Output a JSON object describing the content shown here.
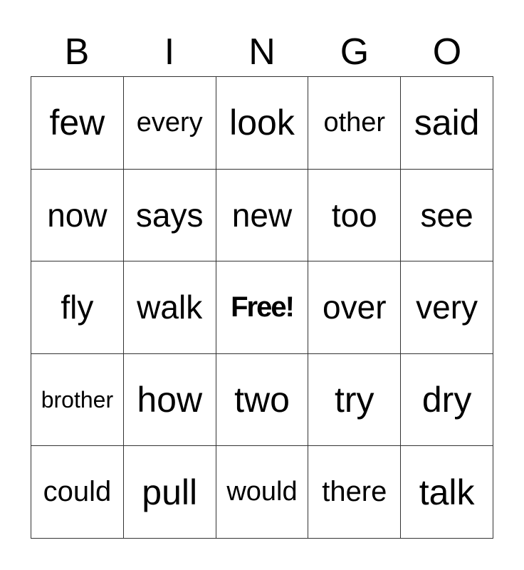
{
  "header": {
    "letters": [
      "B",
      "I",
      "N",
      "G",
      "O"
    ]
  },
  "board": {
    "rows": [
      [
        {
          "word": "few",
          "size": "xl"
        },
        {
          "word": "every",
          "size": "s"
        },
        {
          "word": "look",
          "size": "xl"
        },
        {
          "word": "other",
          "size": "s"
        },
        {
          "word": "said",
          "size": "xl"
        }
      ],
      [
        {
          "word": "now",
          "size": "l"
        },
        {
          "word": "says",
          "size": "l"
        },
        {
          "word": "new",
          "size": "l"
        },
        {
          "word": "too",
          "size": "l"
        },
        {
          "word": "see",
          "size": "l"
        }
      ],
      [
        {
          "word": "fly",
          "size": "l"
        },
        {
          "word": "walk",
          "size": "l"
        },
        {
          "word": "Free!",
          "size": "free"
        },
        {
          "word": "over",
          "size": "l"
        },
        {
          "word": "very",
          "size": "l"
        }
      ],
      [
        {
          "word": "brother",
          "size": "xs"
        },
        {
          "word": "how",
          "size": "xl"
        },
        {
          "word": "two",
          "size": "xl"
        },
        {
          "word": "try",
          "size": "xl"
        },
        {
          "word": "dry",
          "size": "xl"
        }
      ],
      [
        {
          "word": "could",
          "size": "m"
        },
        {
          "word": "pull",
          "size": "xl"
        },
        {
          "word": "would",
          "size": "s"
        },
        {
          "word": "there",
          "size": "m"
        },
        {
          "word": "talk",
          "size": "xl"
        }
      ]
    ]
  }
}
